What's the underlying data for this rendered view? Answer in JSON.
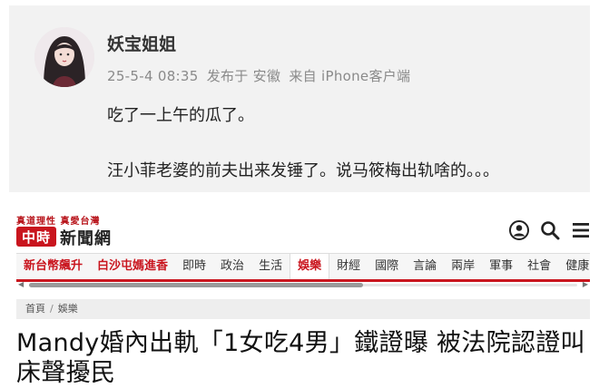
{
  "post": {
    "username": "妖宝姐姐",
    "time": "25-5-4 08:35",
    "location": "发布于 安徽",
    "source": "来自 iPhone客户端",
    "line1": "吃了一上午的瓜了。",
    "line2": "汪小菲老婆的前夫出来发锤了。说马筱梅出轨啥的。。。"
  },
  "site": {
    "slogan": "真道理性  真愛台灣",
    "badge": "中時",
    "name": "新聞網",
    "icons": [
      "user-icon",
      "search-icon",
      "menu-icon"
    ]
  },
  "nav": {
    "items": [
      {
        "label": "新台幣飆升",
        "style": "hot"
      },
      {
        "label": "白沙屯媽進香",
        "style": "hot"
      },
      {
        "label": "即時",
        "style": ""
      },
      {
        "label": "政治",
        "style": ""
      },
      {
        "label": "生活",
        "style": ""
      },
      {
        "label": "娛樂",
        "style": "active"
      },
      {
        "label": "財經",
        "style": ""
      },
      {
        "label": "國際",
        "style": ""
      },
      {
        "label": "言論",
        "style": ""
      },
      {
        "label": "兩岸",
        "style": ""
      },
      {
        "label": "軍事",
        "style": ""
      },
      {
        "label": "社會",
        "style": ""
      },
      {
        "label": "健康",
        "style": ""
      }
    ],
    "accent": "#c9151e"
  },
  "breadcrumb": {
    "home": "首頁",
    "current": "娛樂"
  },
  "headline": "Mandy婚內出軌「1女吃4男」鐵證曝 被法院認證叫床聲擾民"
}
